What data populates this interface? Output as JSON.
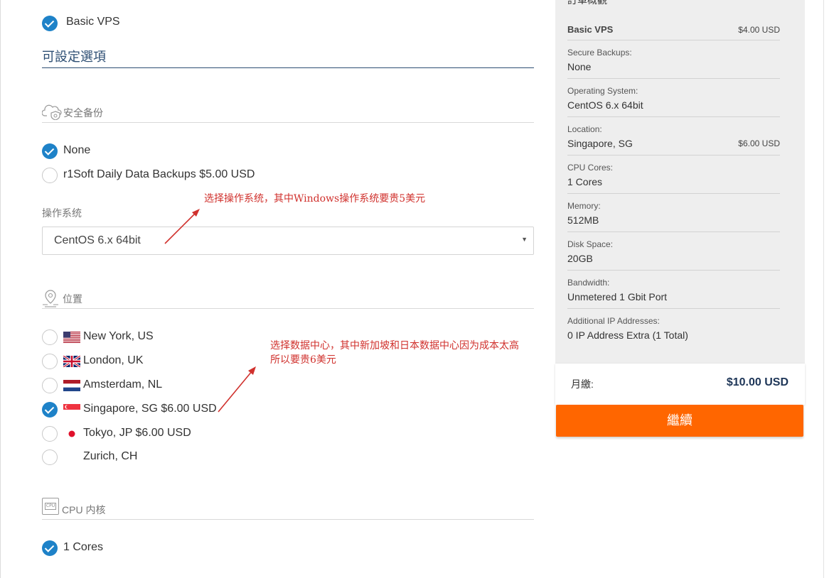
{
  "product": {
    "name": "Basic VPS"
  },
  "configurable": {
    "title": "可設定選項"
  },
  "backups": {
    "section_title": "安全备份",
    "options": [
      {
        "label": "None",
        "selected": true
      },
      {
        "label": "r1Soft Daily Data Backups $5.00 USD",
        "selected": false
      }
    ]
  },
  "os": {
    "label": "操作系统",
    "selected": "CentOS 6.x 64bit"
  },
  "location": {
    "section_title": "位置",
    "options": [
      {
        "label": "New York, US",
        "flag": "us",
        "selected": false
      },
      {
        "label": "London, UK",
        "flag": "uk",
        "selected": false
      },
      {
        "label": "Amsterdam, NL",
        "flag": "nl",
        "selected": false
      },
      {
        "label": "Singapore, SG $6.00 USD",
        "flag": "sg",
        "selected": true
      },
      {
        "label": "Tokyo, JP $6.00 USD",
        "flag": "jp",
        "selected": false
      },
      {
        "label": "Zurich, CH",
        "flag": "none",
        "selected": false
      }
    ]
  },
  "cpu": {
    "section_title": "CPU 内核",
    "icon_text": "CPU",
    "options": [
      {
        "label": "1 Cores",
        "selected": true
      }
    ]
  },
  "annotations": {
    "os_note": "选择操作系统，其中Windows操作系统要贵5美元",
    "location_note_line1": "选择数据中心，其中新加坡和日本数据中心因为成本太高",
    "location_note_line2": "所以要贵6美元",
    "color": "#d0312d"
  },
  "summary": {
    "cut_title": "訂單概觀",
    "rows": [
      {
        "label": "",
        "value": "Basic VPS",
        "price": "$4.00 USD"
      },
      {
        "label": "Secure Backups:",
        "value": "None",
        "price": ""
      },
      {
        "label": "Operating System:",
        "value": "CentOS 6.x 64bit",
        "price": ""
      },
      {
        "label": "Location:",
        "value": "Singapore, SG",
        "price": "$6.00 USD"
      },
      {
        "label": "CPU Cores:",
        "value": "1 Cores",
        "price": ""
      },
      {
        "label": "Memory:",
        "value": "512MB",
        "price": ""
      },
      {
        "label": "Disk Space:",
        "value": "20GB",
        "price": ""
      },
      {
        "label": "Bandwidth:",
        "value": "Unmetered 1 Gbit Port",
        "price": ""
      },
      {
        "label": "Additional IP Addresses:",
        "value": "0 IP Address Extra (1 Total)",
        "price": ""
      }
    ],
    "total_label": "月繳:",
    "total_value": "$10.00 USD",
    "continue_label": "繼續"
  },
  "colors": {
    "accent": "#1e82c8",
    "heading": "#2d4e73",
    "button": "#ff6600",
    "total": "#1d3557"
  }
}
